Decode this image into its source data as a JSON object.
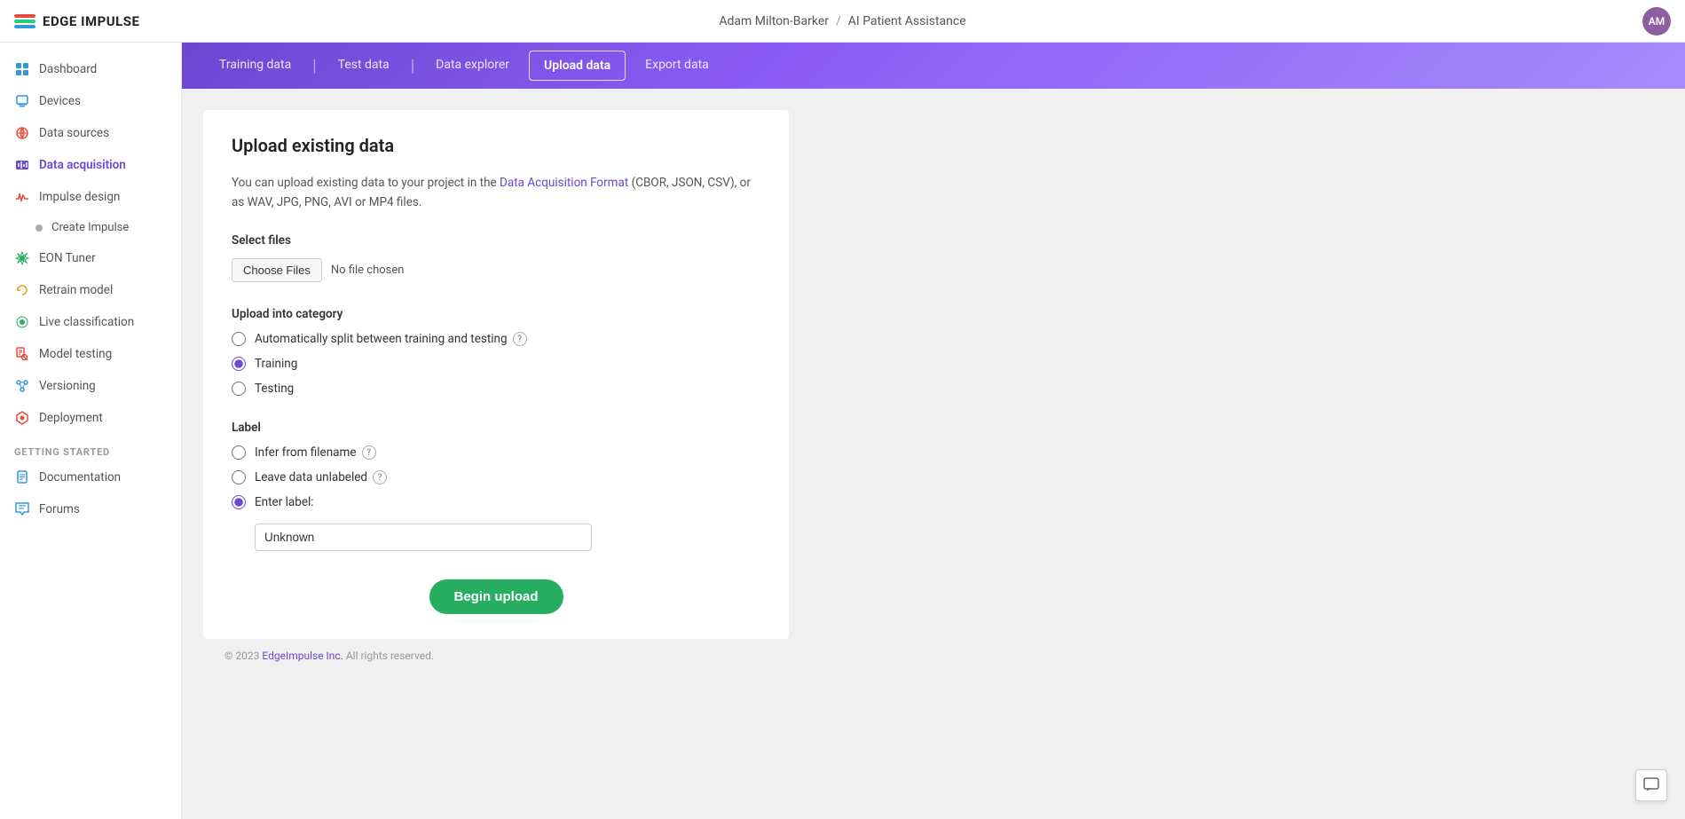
{
  "header": {
    "logo_text": "EDGE IMPULSE",
    "user": "Adam Milton-Barker",
    "project": "AI Patient Assistance",
    "separator": "/",
    "avatar_initials": "AM"
  },
  "sidebar": {
    "items": [
      {
        "id": "dashboard",
        "label": "Dashboard",
        "icon": "grid-icon",
        "icon_class": "icon-dashboard",
        "active": false
      },
      {
        "id": "devices",
        "label": "Devices",
        "icon": "device-icon",
        "icon_class": "icon-devices",
        "active": false
      },
      {
        "id": "data-sources",
        "label": "Data sources",
        "icon": "datasource-icon",
        "icon_class": "icon-datasources",
        "active": false
      },
      {
        "id": "data-acquisition",
        "label": "Data acquisition",
        "icon": "dataacq-icon",
        "icon_class": "icon-dataacquisition",
        "active": true
      },
      {
        "id": "create-impulse",
        "label": "Create Impulse",
        "icon": "dot",
        "active": false,
        "sub": true
      },
      {
        "id": "impulse-design",
        "label": "Impulse design",
        "icon": "impulse-icon",
        "icon_class": "icon-impulse",
        "active": false
      },
      {
        "id": "eon-tuner",
        "label": "EON Tuner",
        "icon": "eon-icon",
        "icon_class": "icon-eon",
        "active": false
      },
      {
        "id": "retrain-model",
        "label": "Retrain model",
        "icon": "retrain-icon",
        "icon_class": "icon-retrain",
        "active": false
      },
      {
        "id": "live-classification",
        "label": "Live classification",
        "icon": "live-icon",
        "icon_class": "icon-live",
        "active": false
      },
      {
        "id": "model-testing",
        "label": "Model testing",
        "icon": "testing-icon",
        "icon_class": "icon-testing",
        "active": false
      },
      {
        "id": "versioning",
        "label": "Versioning",
        "icon": "versioning-icon",
        "icon_class": "icon-versioning",
        "active": false
      },
      {
        "id": "deployment",
        "label": "Deployment",
        "icon": "deployment-icon",
        "icon_class": "icon-deployment",
        "active": false
      }
    ],
    "getting_started_label": "GETTING STARTED",
    "getting_started_items": [
      {
        "id": "documentation",
        "label": "Documentation",
        "icon": "docs-icon",
        "icon_class": "icon-docs"
      },
      {
        "id": "forums",
        "label": "Forums",
        "icon": "forums-icon",
        "icon_class": "icon-forums"
      }
    ]
  },
  "tabs": [
    {
      "id": "training-data",
      "label": "Training data",
      "active": false
    },
    {
      "id": "test-data",
      "label": "Test data",
      "active": false
    },
    {
      "id": "data-explorer",
      "label": "Data explorer",
      "active": false
    },
    {
      "id": "upload-data",
      "label": "Upload data",
      "active": true
    },
    {
      "id": "export-data",
      "label": "Export data",
      "active": false
    }
  ],
  "upload": {
    "title": "Upload existing data",
    "description_part1": "You can upload existing data to your project in the ",
    "description_link": "Data Acquisition Format",
    "description_part2": " (CBOR, JSON, CSV), or as WAV, JPG, PNG, AVI or MP4 files.",
    "select_files_label": "Select files",
    "choose_files_btn": "Choose Files",
    "no_file_text": "No file chosen",
    "upload_category_label": "Upload into category",
    "category_options": [
      {
        "id": "auto-split",
        "label": "Automatically split between training and testing",
        "has_help": true,
        "checked": false
      },
      {
        "id": "training",
        "label": "Training",
        "has_help": false,
        "checked": true
      },
      {
        "id": "testing",
        "label": "Testing",
        "has_help": false,
        "checked": false
      }
    ],
    "label_section": "Label",
    "label_options": [
      {
        "id": "infer-filename",
        "label": "Infer from filename",
        "has_help": true,
        "checked": false
      },
      {
        "id": "leave-unlabeled",
        "label": "Leave data unlabeled",
        "has_help": true,
        "checked": false
      },
      {
        "id": "enter-label",
        "label": "Enter label:",
        "has_help": false,
        "checked": true
      }
    ],
    "label_value": "Unknown",
    "begin_upload_btn": "Begin upload"
  },
  "footer": {
    "copyright": "© 2023 ",
    "company_link": "EdgeImpulse Inc.",
    "rights": " All rights reserved."
  }
}
